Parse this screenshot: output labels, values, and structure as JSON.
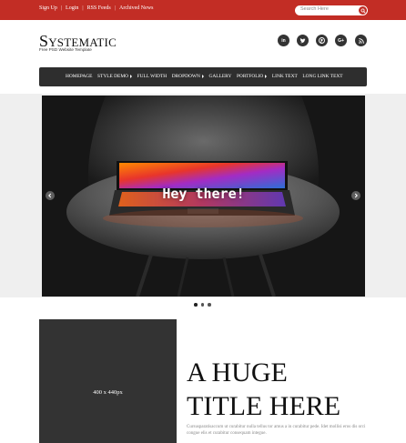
{
  "topbar": {
    "links": [
      "Sign Up",
      "Login",
      "RSS Feeds",
      "Archived News"
    ],
    "separator": "|",
    "search_placeholder": "Search Here"
  },
  "header": {
    "logo": "Systematic",
    "tagline": "Free PSD Website Template",
    "social": [
      {
        "icon": "linkedin-icon",
        "glyph": "in"
      },
      {
        "icon": "twitter-icon",
        "glyph": ""
      },
      {
        "icon": "pinterest-icon",
        "glyph": ""
      },
      {
        "icon": "google-plus-icon",
        "glyph": "G+"
      },
      {
        "icon": "rss-icon",
        "glyph": ""
      }
    ]
  },
  "nav": {
    "items": [
      {
        "label": "HOMEPAGE",
        "has_caret": false
      },
      {
        "label": "STYLE DEMO",
        "has_caret": true
      },
      {
        "label": "FULL WIDTH",
        "has_caret": false
      },
      {
        "label": "DROPDOWN",
        "has_caret": true
      },
      {
        "label": "GALLERY",
        "has_caret": false
      },
      {
        "label": "PORTFOLIO",
        "has_caret": true
      },
      {
        "label": "LINK TEXT",
        "has_caret": false
      },
      {
        "label": "LONG LINK TEXT",
        "has_caret": false
      }
    ]
  },
  "slider": {
    "screen_text": "Hey there!",
    "dots": 3,
    "active_dot": 0
  },
  "feature": {
    "placeholder_label": "400 x 440px",
    "title_line1": "A HUGE",
    "title_line2": "TITLE HERE",
    "body": "Cursusparatisaccum ut curabitur nulla tellus tor amus a in curabitur pede. Idet mollisi eros dis orci congue elis et curabitur consequam integue."
  },
  "colors": {
    "brand_red": "#c22d25",
    "nav_bg": "#2e2e2e",
    "placeholder_bg": "#333333"
  }
}
